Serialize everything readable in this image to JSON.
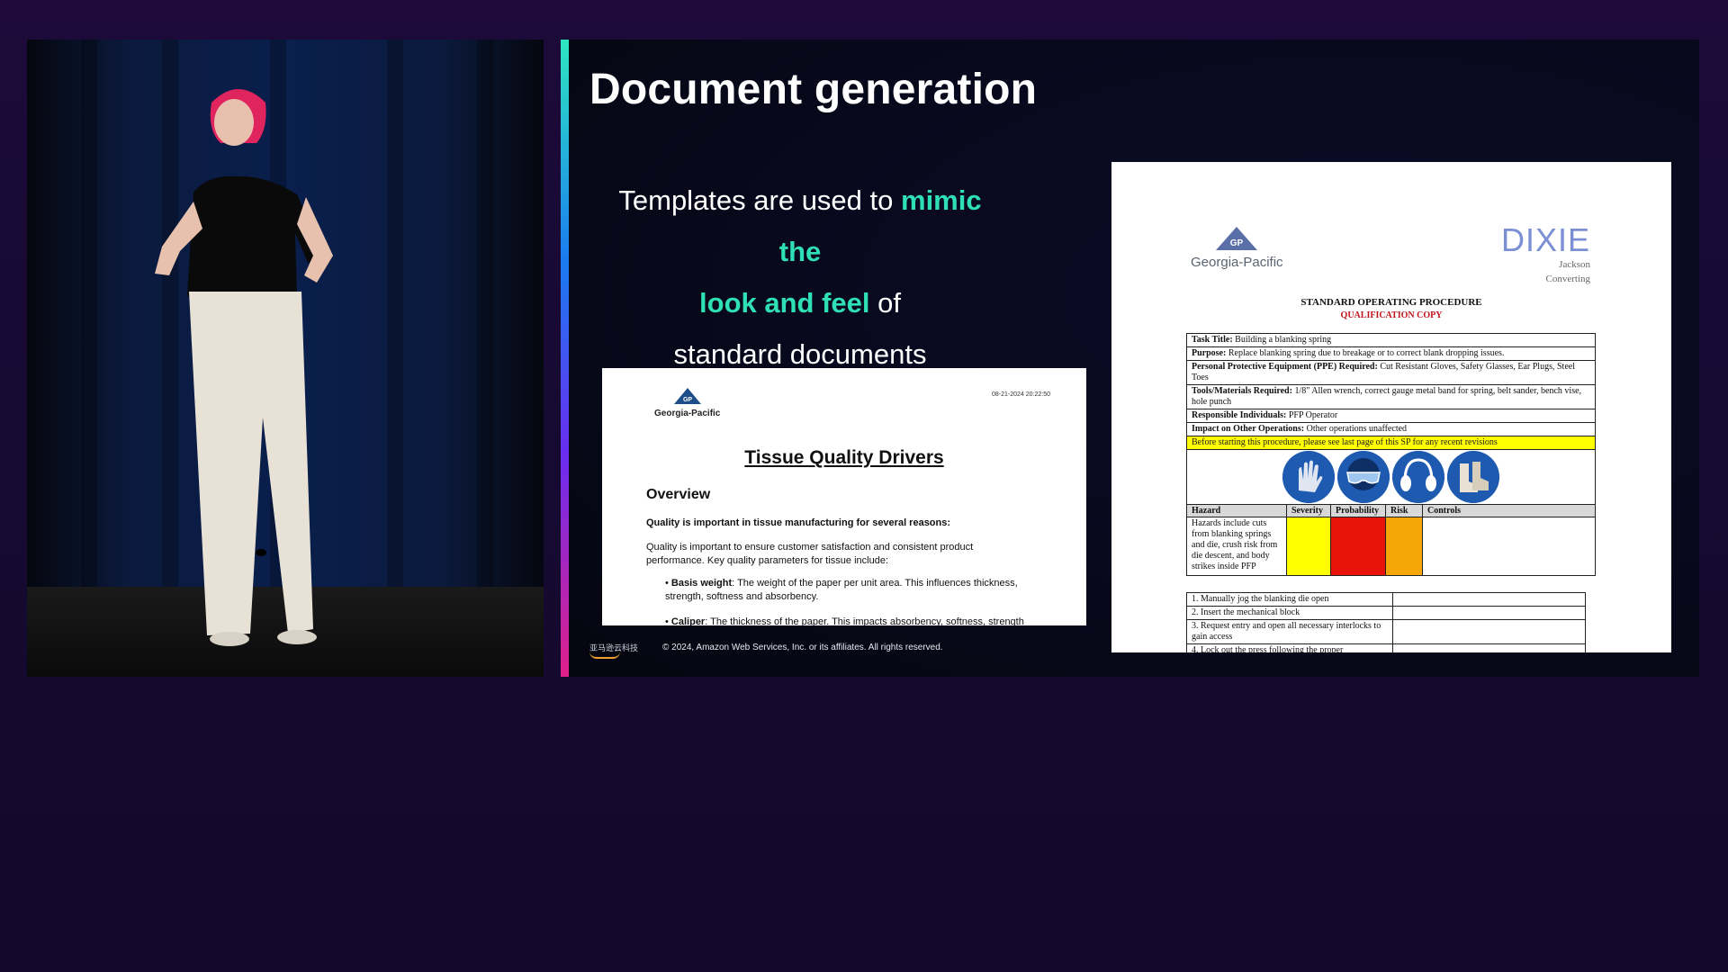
{
  "slide": {
    "title": "Document generation",
    "lead_part1": "Templates are used to ",
    "lead_highlight1": "mimic the",
    "lead_highlight2": "look and feel",
    "lead_part2": " of",
    "lead_part3": "standard documents",
    "footer_logo": "亚马逊云科技",
    "copyright": "© 2024, Amazon Web Services, Inc. or its affiliates. All rights reserved.",
    "accent_colors": [
      "#2ee6c2",
      "#1a7bf0",
      "#6a2cf0",
      "#e0208a"
    ]
  },
  "doc1": {
    "logo": "Georgia-Pacific",
    "logo_mark": "GP",
    "timestamp": "08-21-2024 20:22:50",
    "title": "Tissue Quality Drivers",
    "heading": "Overview",
    "intro_bold": "Quality is important in tissue manufacturing for several reasons:",
    "intro": "Quality is important to ensure customer satisfaction and consistent product performance. Key quality parameters for tissue include:",
    "bullets": [
      {
        "term": "Basis weight",
        "text": ": The weight of the paper per unit area. This influences thickness, strength, softness and absorbency."
      },
      {
        "term": "Caliper",
        "text": ": The thickness of the paper. This impacts absorbency, softness, strength"
      }
    ]
  },
  "doc2": {
    "logo_left": "Georgia-Pacific",
    "logo_left_mark": "GP",
    "logo_right": "DIXIE",
    "logo_right_sub1": "Jackson",
    "logo_right_sub2": "Converting",
    "heading": "STANDARD OPERATING PROCEDURE",
    "subheading": "QUALIFICATION COPY",
    "fields": [
      {
        "label": "Task Title:",
        "value": " Building a blanking spring"
      },
      {
        "label": "Purpose:",
        "value": " Replace blanking spring due to breakage or to correct blank dropping issues."
      },
      {
        "label": "Personal Protective Equipment (PPE) Required:",
        "value": " Cut Resistant Gloves, Safety Glasses, Ear Plugs, Steel Toes"
      },
      {
        "label": "Tools/Materials Required:",
        "value": " 1/8\" Allen wrench, correct gauge metal band for spring, belt sander, bench vise, hole punch"
      },
      {
        "label": "Responsible Individuals:",
        "value": " PFP Operator"
      },
      {
        "label": "Impact on Other Operations:",
        "value": " Other operations unaffected"
      }
    ],
    "warning": "Before starting this procedure, please see last page of this SP for any recent revisions",
    "ppe_icons": [
      "gloves-icon",
      "safety-glasses-icon",
      "ear-protection-icon",
      "steel-toe-boots-icon"
    ],
    "hazard_table": {
      "headers": [
        "Hazard",
        "Severity",
        "Probability",
        "Risk",
        "Controls"
      ],
      "hazard_text": "Hazards include cuts from blanking springs and die, crush risk from die descent, and body strikes inside PFP",
      "severity_color": "#ffff00",
      "probability_color": "#e8140c",
      "risk_color": "#f5a70a"
    },
    "steps": [
      "1. Manually jog the blanking die open",
      "2. Insert the mechanical block",
      "3. Request entry and open all necessary interlocks to gain access",
      "4. Lock out the press following the proper"
    ]
  }
}
